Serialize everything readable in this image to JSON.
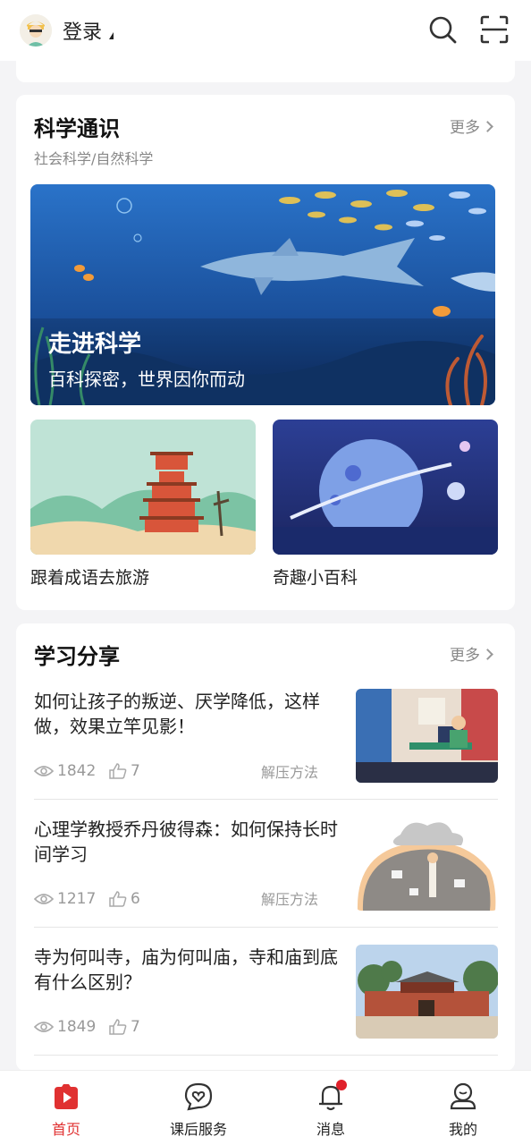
{
  "header": {
    "login_label": "登录"
  },
  "science": {
    "title": "科学通识",
    "subtitle": "社会科学/自然科学",
    "more": "更多",
    "banner": {
      "title": "走进科学",
      "subtitle": "百科探密，世界因你而动"
    },
    "items": [
      {
        "label": "跟着成语去旅游"
      },
      {
        "label": "奇趣小百科"
      }
    ]
  },
  "learning": {
    "title": "学习分享",
    "more": "更多",
    "articles": [
      {
        "title": "如何让孩子的叛逆、厌学降低，这样做，效果立竿见影！",
        "views": "1842",
        "likes": "7",
        "tag": "解压方法"
      },
      {
        "title": "心理学教授乔丹彼得森：如何保持长时间学习",
        "views": "1217",
        "likes": "6",
        "tag": "解压方法"
      },
      {
        "title": "寺为何叫寺，庙为何叫庙，寺和庙到底有什么区别？",
        "views": "1849",
        "likes": "7",
        "tag": ""
      }
    ]
  },
  "nav": {
    "items": [
      {
        "label": "首页"
      },
      {
        "label": "课后服务"
      },
      {
        "label": "消息"
      },
      {
        "label": "我的"
      }
    ],
    "active_color": "#e03131"
  }
}
